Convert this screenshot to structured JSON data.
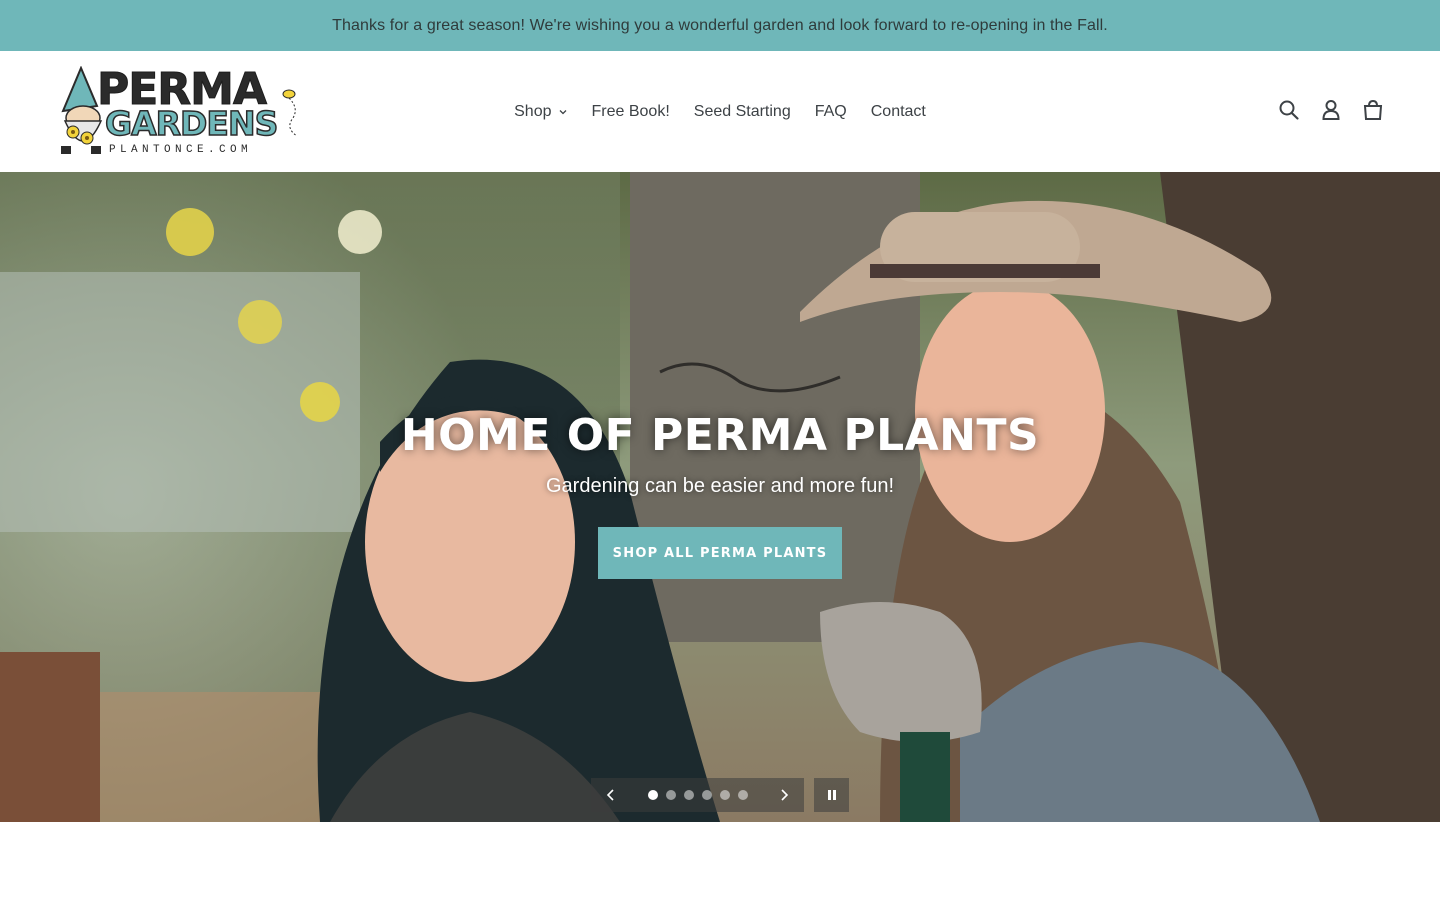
{
  "announcement": {
    "text": "Thanks for a great season! We're wishing you a wonderful garden and look forward to re-opening in the Fall."
  },
  "header": {
    "logo": {
      "line1": "PERMA",
      "line2": "GARDENS",
      "domain": "PLANTONCE.COM"
    },
    "nav": {
      "items": [
        {
          "label": "Shop",
          "has_dropdown": true
        },
        {
          "label": "Free Book!"
        },
        {
          "label": "Seed Starting"
        },
        {
          "label": "FAQ"
        },
        {
          "label": "Contact"
        }
      ]
    },
    "icons": [
      "search-icon",
      "account-icon",
      "cart-icon"
    ]
  },
  "hero": {
    "title": "HOME OF PERMA PLANTS",
    "subtitle": "Gardening can be easier and more fun!",
    "button_label": "SHOP ALL PERMA PLANTS",
    "slides_count": 6,
    "active_slide": 1
  },
  "colors": {
    "accent": "#6fb7b9",
    "text": "#3d4246",
    "background": "#ffffff"
  }
}
